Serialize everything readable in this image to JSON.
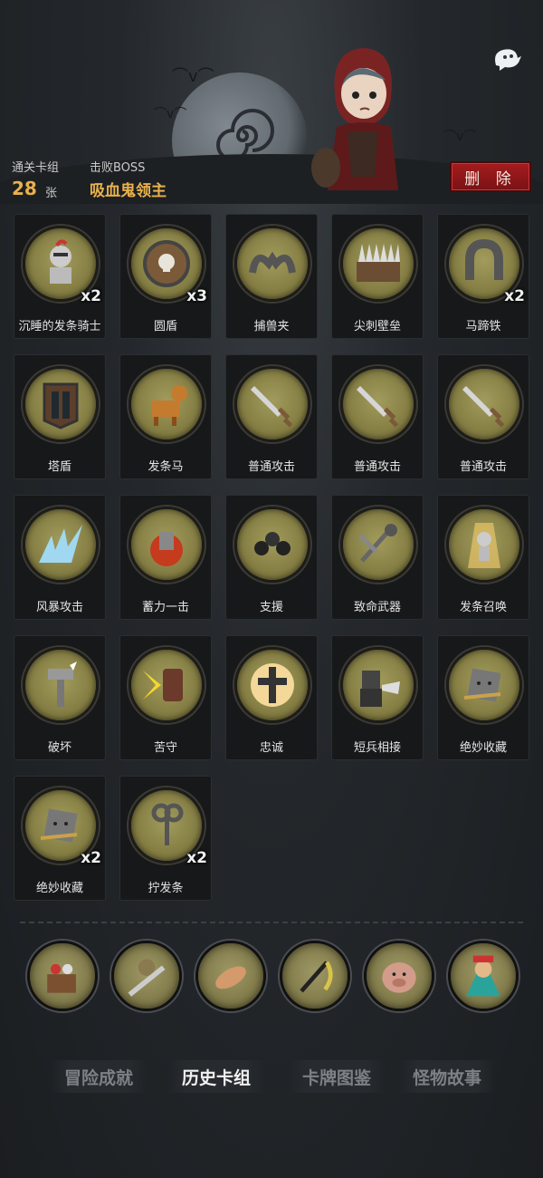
{
  "header": {
    "cleared_label": "通关卡组",
    "cleared_count": "28",
    "cleared_unit": "张",
    "boss_label": "击败BOSS",
    "boss_name": "吸血鬼领主",
    "delete_label": "删 除"
  },
  "cards": [
    {
      "name": "沉睡的发条骑士",
      "count": "x2",
      "icon": "sleeping-knight-icon"
    },
    {
      "name": "圆盾",
      "count": "x3",
      "icon": "round-shield-icon"
    },
    {
      "name": "捕兽夹",
      "count": "",
      "icon": "bear-trap-icon"
    },
    {
      "name": "尖刺壁垒",
      "count": "",
      "icon": "spike-barrier-icon"
    },
    {
      "name": "马蹄铁",
      "count": "x2",
      "icon": "horseshoe-icon"
    },
    {
      "name": "塔盾",
      "count": "",
      "icon": "tower-shield-icon"
    },
    {
      "name": "发条马",
      "count": "",
      "icon": "clockwork-horse-icon"
    },
    {
      "name": "普通攻击",
      "count": "",
      "icon": "sword-icon"
    },
    {
      "name": "普通攻击",
      "count": "",
      "icon": "sword-icon"
    },
    {
      "name": "普通攻击",
      "count": "",
      "icon": "sword-icon"
    },
    {
      "name": "风暴攻击",
      "count": "",
      "icon": "storm-attack-icon"
    },
    {
      "name": "蓄力一击",
      "count": "",
      "icon": "charged-strike-icon"
    },
    {
      "name": "支援",
      "count": "",
      "icon": "support-icon"
    },
    {
      "name": "致命武器",
      "count": "",
      "icon": "deadly-weapons-icon"
    },
    {
      "name": "发条召唤",
      "count": "",
      "icon": "clockwork-summon-icon"
    },
    {
      "name": "破坏",
      "count": "",
      "icon": "destroy-icon"
    },
    {
      "name": "苦守",
      "count": "",
      "icon": "hold-fast-icon"
    },
    {
      "name": "忠诚",
      "count": "",
      "icon": "loyalty-cross-icon"
    },
    {
      "name": "短兵相接",
      "count": "",
      "icon": "close-combat-icon"
    },
    {
      "name": "绝妙收藏",
      "count": "",
      "icon": "treasure-collection-icon"
    },
    {
      "name": "绝妙收藏",
      "count": "x2",
      "icon": "treasure-collection-icon"
    },
    {
      "name": "拧发条",
      "count": "x2",
      "icon": "wind-up-key-icon"
    }
  ],
  "bosses": [
    {
      "icon": "toy-box-boss-icon"
    },
    {
      "icon": "knight-boss-icon"
    },
    {
      "icon": "hand-boss-icon"
    },
    {
      "icon": "scythe-boss-icon"
    },
    {
      "icon": "pig-boss-icon"
    },
    {
      "icon": "vampire-lord-boss-icon"
    }
  ],
  "tabs": [
    {
      "label": "冒险成就",
      "active": false
    },
    {
      "label": "历史卡组",
      "active": true
    },
    {
      "label": "卡牌图鉴",
      "active": false
    },
    {
      "label": "怪物故事",
      "active": false
    }
  ]
}
